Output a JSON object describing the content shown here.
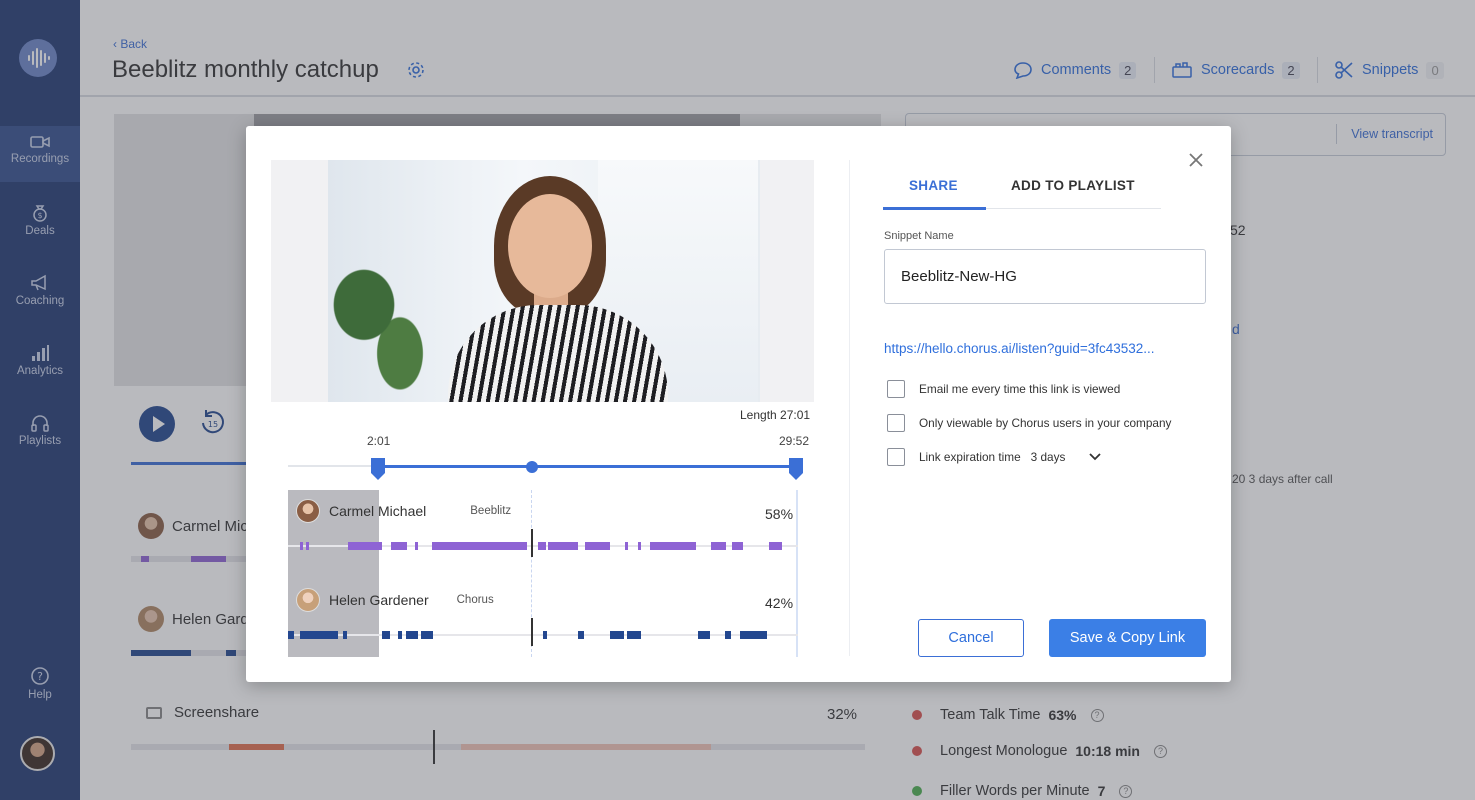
{
  "sidebar": {
    "items": [
      {
        "label": "Recordings",
        "icon": "video-camera-icon"
      },
      {
        "label": "Deals",
        "icon": "money-bag-icon"
      },
      {
        "label": "Coaching",
        "icon": "megaphone-icon"
      },
      {
        "label": "Analytics",
        "icon": "bar-chart-icon"
      },
      {
        "label": "Playlists",
        "icon": "headphones-icon"
      }
    ],
    "help": "Help"
  },
  "header": {
    "back": "‹ Back",
    "title": "Beeblitz monthly catchup",
    "comments_label": "Comments",
    "comments_count": "2",
    "scorecards_label": "Scorecards",
    "scorecards_count": "2",
    "snippets_label": "Snippets",
    "snippets_count": "0"
  },
  "background": {
    "view_transcript": "View transcript",
    "frag_52": "52",
    "frag_d": "d",
    "frag_days": "20 3 days after call",
    "speakers": [
      {
        "name": "Carmel Mic"
      },
      {
        "name": "Helen Gard"
      }
    ],
    "screenshare": {
      "label": "Screenshare",
      "pct": "32%"
    },
    "metrics": [
      {
        "label": "Team Talk Time",
        "value": "63%",
        "color": "#d9534f"
      },
      {
        "label": "Longest Monologue",
        "value": "10:18 min",
        "color": "#d9534f"
      },
      {
        "label": "Filler Words per Minute",
        "value": "7",
        "color": "#4caf50"
      }
    ]
  },
  "modal": {
    "length_label": "Length 27:01",
    "time_start": "2:01",
    "time_end": "29:52",
    "speakers": [
      {
        "name": "Carmel Michael",
        "org": "Beeblitz",
        "pct": "58%",
        "color": "#8e63d4"
      },
      {
        "name": "Helen Gardener",
        "org": "Chorus",
        "pct": "42%",
        "color": "#23478f"
      }
    ],
    "tabs": {
      "share": "SHARE",
      "playlist": "ADD TO PLAYLIST"
    },
    "snippet_name_label": "Snippet Name",
    "snippet_name_value": "Beeblitz-New-HG",
    "share_url": "https://hello.chorus.ai/listen?guid=3fc43532...",
    "options": {
      "email": "Email me every time this link is viewed",
      "only_chorus": "Only viewable by Chorus users in your company",
      "expiration_label": "Link expiration time",
      "expiration_value": "3 days"
    },
    "cancel": "Cancel",
    "save": "Save & Copy Link"
  }
}
